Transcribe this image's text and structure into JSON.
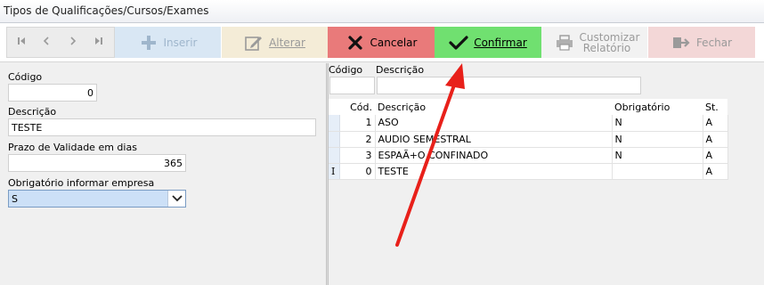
{
  "window": {
    "title": "Tipos de Qualificações/Cursos/Exames"
  },
  "toolbar": {
    "navigation": [
      "first",
      "previous",
      "next",
      "last"
    ],
    "buttons": [
      {
        "label": "Inserir",
        "bg": "#d9e7f4",
        "fg": "#9fb6cc",
        "icon": "plus-icon"
      },
      {
        "label": "Alterar",
        "bg": "#f4ecd7",
        "fg": "#9a9a9a",
        "icon": "edit-icon"
      },
      {
        "label": "Cancelar",
        "bg": "#e97a7a",
        "fg": "#000000",
        "icon": "x-icon"
      },
      {
        "label": "Confirmar",
        "bg": "#70e070",
        "fg": "#000000",
        "icon": "check-icon"
      },
      {
        "label": "Customizar Relatório",
        "bg": "#f2f2f2",
        "fg": "#9a9a9a",
        "icon": "printer-icon"
      },
      {
        "label": "Fechar",
        "bg": "#f3d7d7",
        "fg": "#9a9a9a",
        "icon": "exit-icon"
      }
    ]
  },
  "form": {
    "codigo_label": "Código",
    "codigo_value": "0",
    "descricao_label": "Descrição",
    "descricao_value": "TESTE",
    "prazo_label": "Prazo de Validade em dias",
    "prazo_value": "365",
    "obrigatorio_label": "Obrigatório informar empresa",
    "obrigatorio_value": "S"
  },
  "filter": {
    "codigo_label": "Código",
    "descricao_label": "Descrição"
  },
  "grid": {
    "columns": [
      "Cód.",
      "Descrição",
      "Obrigatório",
      "St."
    ],
    "rows": [
      {
        "indicator": "",
        "cod": "1",
        "descricao": "ASO",
        "obrigatorio": "N",
        "st": "A"
      },
      {
        "indicator": "",
        "cod": "2",
        "descricao": "AUDIO SEMESTRAL",
        "obrigatorio": "N",
        "st": "A"
      },
      {
        "indicator": "",
        "cod": "3",
        "descricao": "ESPAÃ+O CONFINADO",
        "obrigatorio": "N",
        "st": "A"
      },
      {
        "indicator": "I",
        "cod": "0",
        "descricao": "TESTE",
        "obrigatorio": "",
        "st": "A"
      }
    ]
  },
  "colors": {
    "annotation_arrow": "#e8201a",
    "focus_blue": "#cce0f7"
  }
}
